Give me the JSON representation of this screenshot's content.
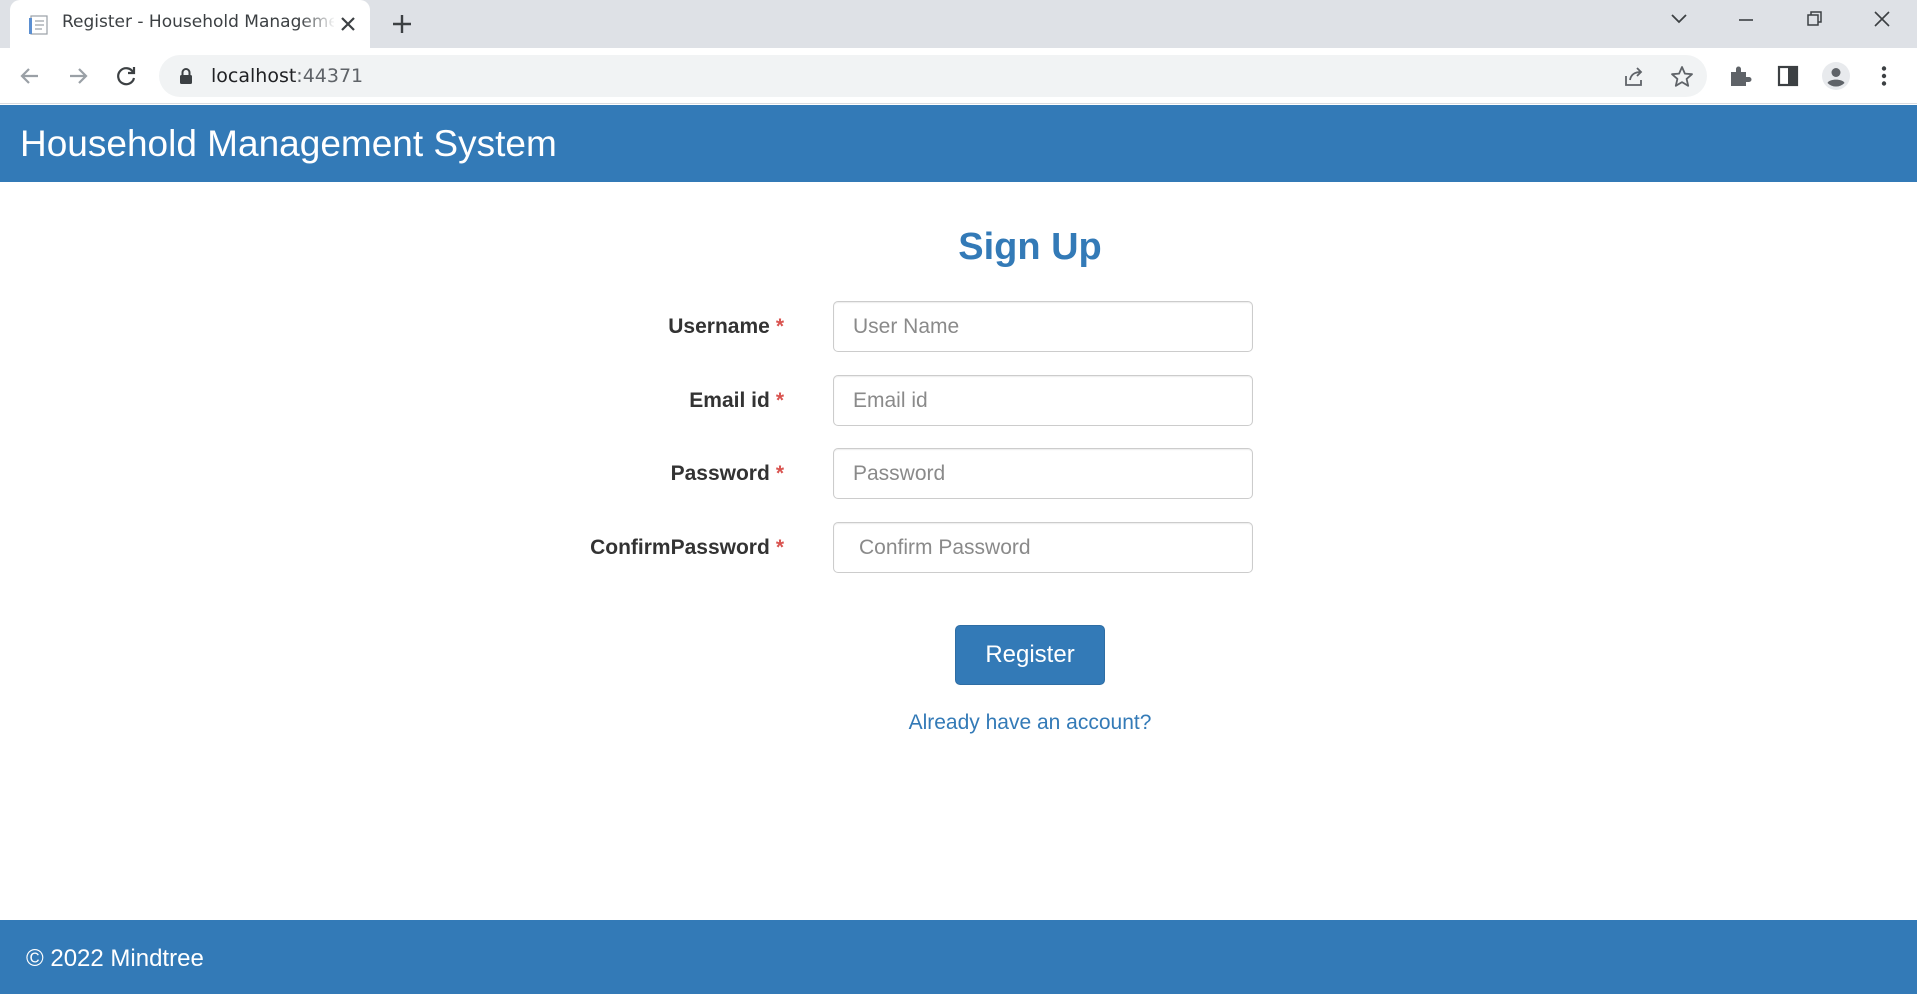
{
  "browser": {
    "tab_title": "Register - Household Management System",
    "url_host": "localhost",
    "url_port": ":44371",
    "icons": [
      "page-favicon-icon",
      "close-icon",
      "plus-icon",
      "chevron-down-icon",
      "minimize-icon",
      "restore-icon",
      "close-window-icon",
      "back-icon",
      "forward-icon",
      "reload-icon",
      "lock-icon",
      "share-icon",
      "star-icon",
      "extensions-icon",
      "side-panel-icon",
      "profile-icon",
      "menu-icon"
    ]
  },
  "navbar": {
    "brand": "Household Management System"
  },
  "form": {
    "title": "Sign Up",
    "required_marker": "*",
    "fields": [
      {
        "label": "Username",
        "placeholder": "User Name",
        "type": "text"
      },
      {
        "label": "Email id",
        "placeholder": "Email id",
        "type": "email"
      },
      {
        "label": "Password",
        "placeholder": "Password",
        "type": "password"
      },
      {
        "label": "ConfirmPassword",
        "placeholder": "Confirm Password",
        "type": "password"
      }
    ],
    "submit_label": "Register",
    "login_link": "Already have an account?"
  },
  "footer": {
    "text": "© 2022 Mindtree"
  },
  "colors": {
    "primary": "#337ab7",
    "required": "#d9534f",
    "tabstrip": "#dee1e6"
  }
}
